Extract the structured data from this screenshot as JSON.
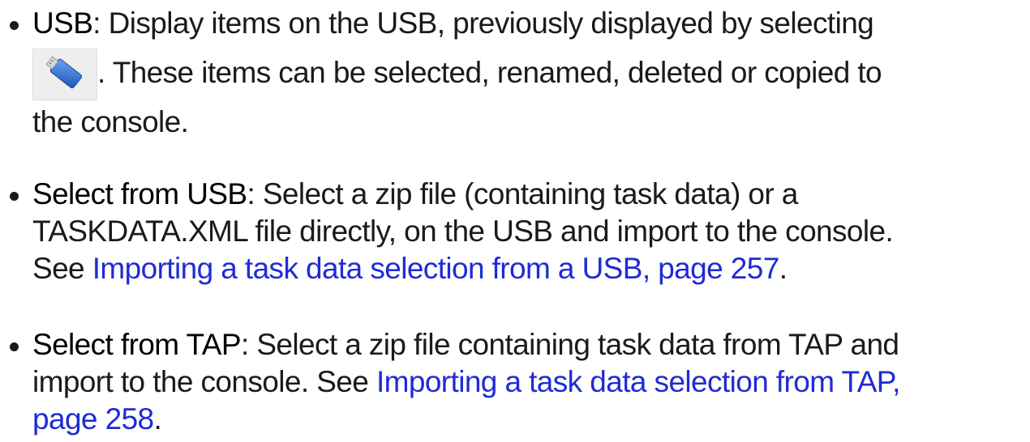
{
  "items": [
    {
      "term": "USB",
      "text_line1": ": Display items on the USB, previously displayed by selecting",
      "icon": "usb-drive-icon",
      "text_line2": ". These items can be selected, renamed, deleted or copied to",
      "text_line3": "the console."
    },
    {
      "term": "Select from USB",
      "text_line1": ": Select a zip file (containing task data) or a",
      "text_line2": "TASKDATA.XML file directly, on the USB and import to the console.",
      "see_label": "See ",
      "link": "Importing a task data selection from a USB, page 257",
      "end": "."
    },
    {
      "term": "Select from TAP",
      "text_line1": ": Select a zip file containing task data from TAP and",
      "text_line2_prefix": "import to the console. See ",
      "link_part1": "Importing a task data selection from TAP,",
      "link_part2": "page 258",
      "end": "."
    }
  ],
  "colors": {
    "text": "#1a1a1a",
    "link": "#1f2bd6",
    "icon_bg": "#eeeeee",
    "usb_blue": "#2f6fd0"
  }
}
